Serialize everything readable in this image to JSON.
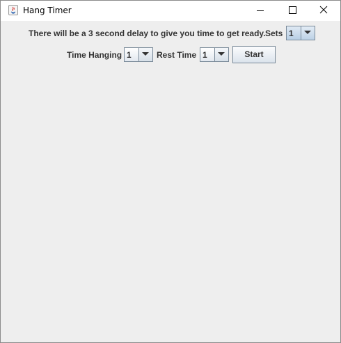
{
  "window": {
    "title": "Hang Timer",
    "app_icon": "java-icon",
    "controls": {
      "minimize_icon": "minimize-icon",
      "maximize_icon": "maximize-icon",
      "close_icon": "close-icon"
    }
  },
  "form": {
    "delay_message": "There will be a 3 second delay to give you time to get ready.",
    "sets_label": "Sets",
    "sets_value": "1",
    "time_hanging_label": "Time Hanging",
    "time_hanging_value": "1",
    "rest_time_label": "Rest Time",
    "rest_time_value": "1",
    "start_label": "Start",
    "dropdown_icon": "triangle-down-icon"
  },
  "colors": {
    "background": "#eeeeee",
    "titlebar": "#ffffff",
    "text": "#333333",
    "control_border": "#7a8a99"
  }
}
